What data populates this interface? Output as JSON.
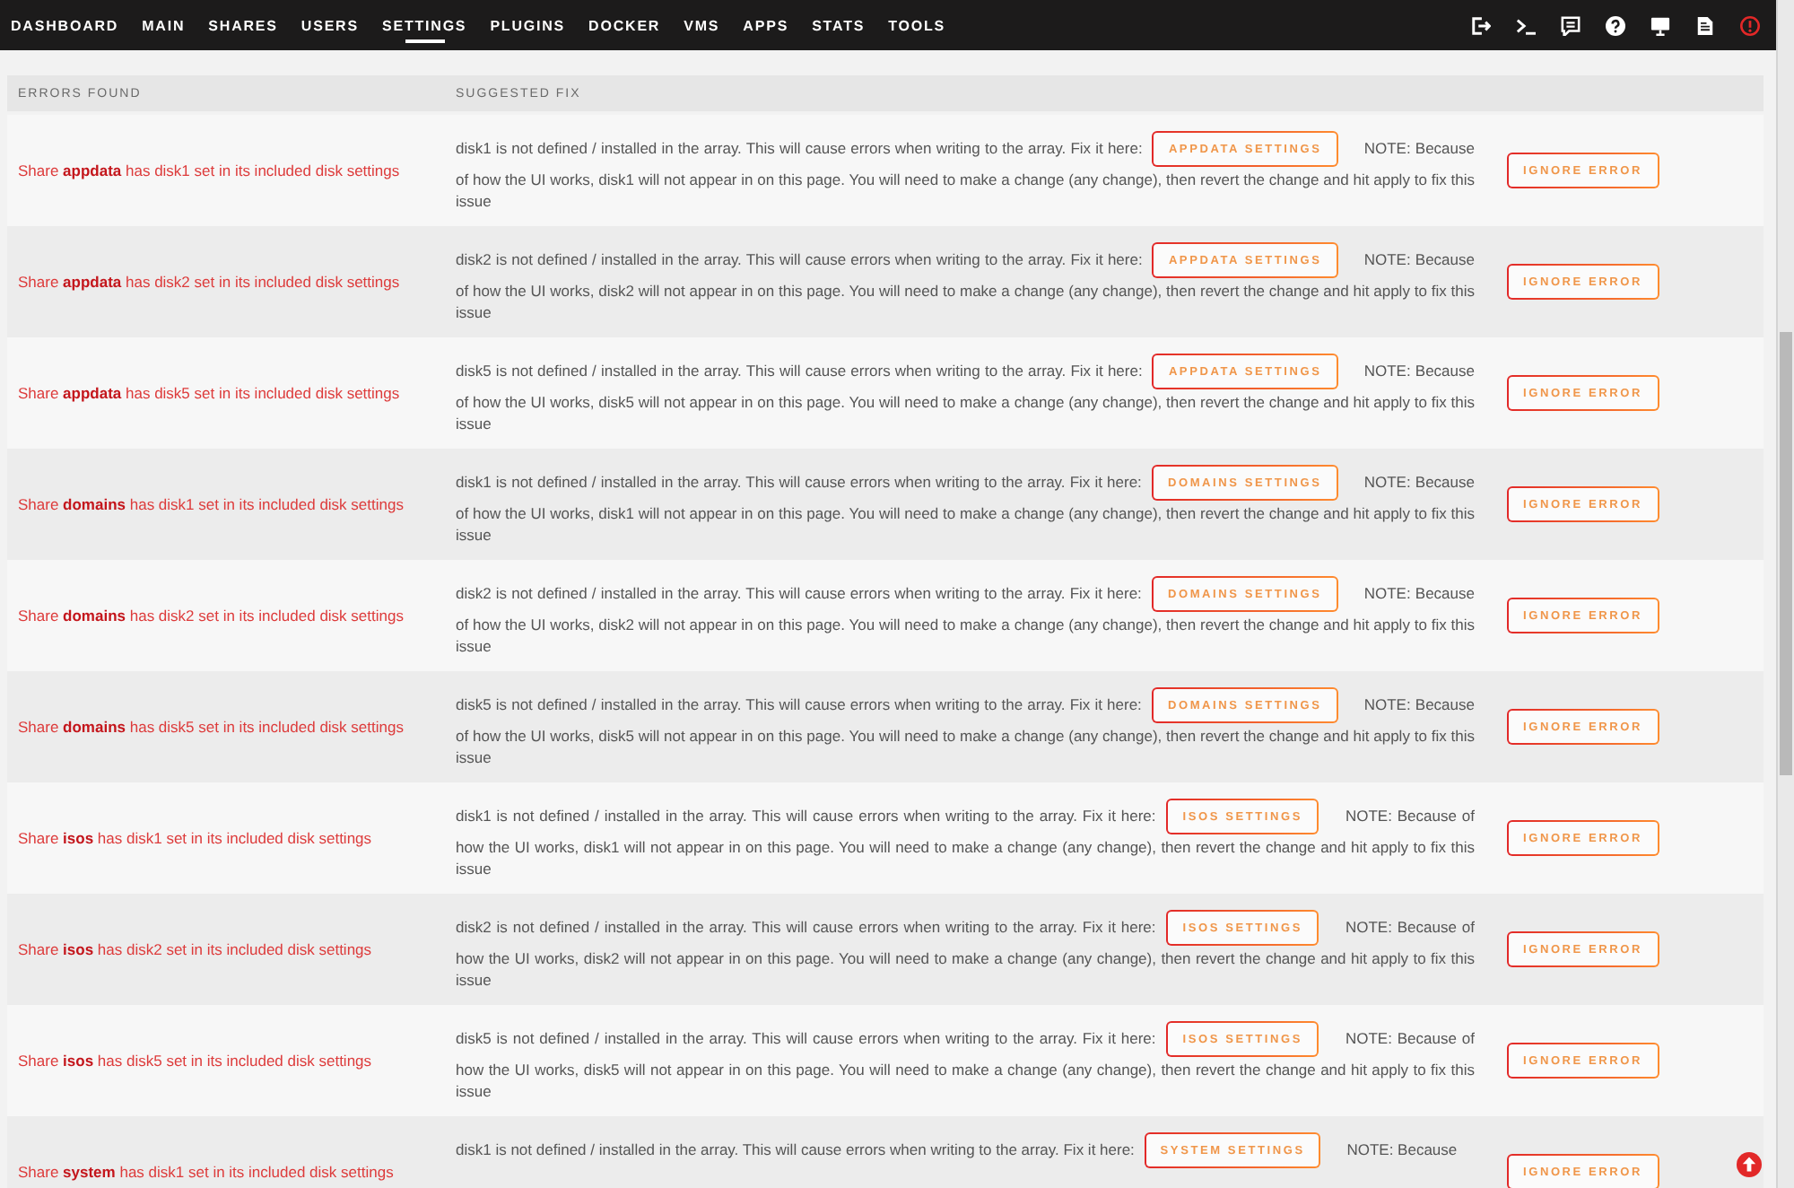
{
  "nav": {
    "tabs": [
      {
        "label": "DASHBOARD",
        "selected": false
      },
      {
        "label": "MAIN",
        "selected": false
      },
      {
        "label": "SHARES",
        "selected": false
      },
      {
        "label": "USERS",
        "selected": false
      },
      {
        "label": "SETTINGS",
        "selected": true
      },
      {
        "label": "PLUGINS",
        "selected": false
      },
      {
        "label": "DOCKER",
        "selected": false
      },
      {
        "label": "VMS",
        "selected": false
      },
      {
        "label": "APPS",
        "selected": false
      },
      {
        "label": "STATS",
        "selected": false
      },
      {
        "label": "TOOLS",
        "selected": false
      }
    ]
  },
  "table": {
    "columns": [
      "ERRORS FOUND",
      "SUGGESTED FIX"
    ],
    "rows": [
      {
        "error": "Share **appdata** has disk1 set in its included disk settings",
        "fix": "disk1 is not defined / installed in the array. This will cause errors when writing to the array. Fix it here:",
        "link": "APPDATA SETTINGS",
        "note": "NOTE: Because of how the UI works, disk1 will not appear in on this page. You will need to make a change (any change), then revert the change and hit apply to fix this issue",
        "action": "IGNORE ERROR"
      },
      {
        "error": "Share **appdata** has disk2 set in its included disk settings",
        "fix": "disk2 is not defined / installed in the array. This will cause errors when writing to the array. Fix it here:",
        "link": "APPDATA SETTINGS",
        "note": "NOTE: Because of how the UI works, disk2 will not appear in on this page. You will need to make a change (any change), then revert the change and hit apply to fix this issue",
        "action": "IGNORE ERROR"
      },
      {
        "error": "Share **appdata** has disk5 set in its included disk settings",
        "fix": "disk5 is not defined / installed in the array. This will cause errors when writing to the array. Fix it here:",
        "link": "APPDATA SETTINGS",
        "note": "NOTE: Because of how the UI works, disk5 will not appear in on this page. You will need to make a change (any change), then revert the change and hit apply to fix this issue",
        "action": "IGNORE ERROR"
      },
      {
        "error": "Share **domains** has disk1 set in its included disk settings",
        "fix": "disk1 is not defined / installed in the array. This will cause errors when writing to the array. Fix it here:",
        "link": "DOMAINS SETTINGS",
        "note": "NOTE: Because of how the UI works, disk1 will not appear in on this page. You will need to make a change (any change), then revert the change and hit apply to fix this issue",
        "action": "IGNORE ERROR"
      },
      {
        "error": "Share **domains** has disk2 set in its included disk settings",
        "fix": "disk2 is not defined / installed in the array. This will cause errors when writing to the array. Fix it here:",
        "link": "DOMAINS SETTINGS",
        "note": "NOTE: Because of how the UI works, disk2 will not appear in on this page. You will need to make a change (any change), then revert the change and hit apply to fix this issue",
        "action": "IGNORE ERROR"
      },
      {
        "error": "Share **domains** has disk5 set in its included disk settings",
        "fix": "disk5 is not defined / installed in the array. This will cause errors when writing to the array. Fix it here:",
        "link": "DOMAINS SETTINGS",
        "note": "NOTE: Because of how the UI works, disk5 will not appear in on this page. You will need to make a change (any change), then revert the change and hit apply to fix this issue",
        "action": "IGNORE ERROR"
      },
      {
        "error": "Share **isos** has disk1 set in its included disk settings",
        "fix": "disk1 is not defined / installed in the array. This will cause errors when writing to the array. Fix it here:",
        "link": "ISOS SETTINGS",
        "note": "NOTE: Because of how the UI works, disk1 will not appear in on this page. You will need to make a change (any change), then revert the change and hit apply to fix this issue",
        "action": "IGNORE ERROR"
      },
      {
        "error": "Share **isos** has disk2 set in its included disk settings",
        "fix": "disk2 is not defined / installed in the array. This will cause errors when writing to the array. Fix it here:",
        "link": "ISOS SETTINGS",
        "note": "NOTE: Because of how the UI works, disk2 will not appear in on this page. You will need to make a change (any change), then revert the change and hit apply to fix this issue",
        "action": "IGNORE ERROR"
      },
      {
        "error": "Share **isos** has disk5 set in its included disk settings",
        "fix": "disk5 is not defined / installed in the array. This will cause errors when writing to the array. Fix it here:",
        "link": "ISOS SETTINGS",
        "note": "NOTE: Because of how the UI works, disk5 will not appear in on this page. You will need to make a change (any change), then revert the change and hit apply to fix this issue",
        "action": "IGNORE ERROR"
      },
      {
        "error": "Share **system** has disk1 set in its included disk settings",
        "fix": "disk1 is not defined / installed in the array. This will cause errors when writing to the array. Fix it here:",
        "link": "SYSTEM SETTINGS",
        "note": "NOTE: Because",
        "action": "IGNORE ERROR"
      }
    ]
  }
}
